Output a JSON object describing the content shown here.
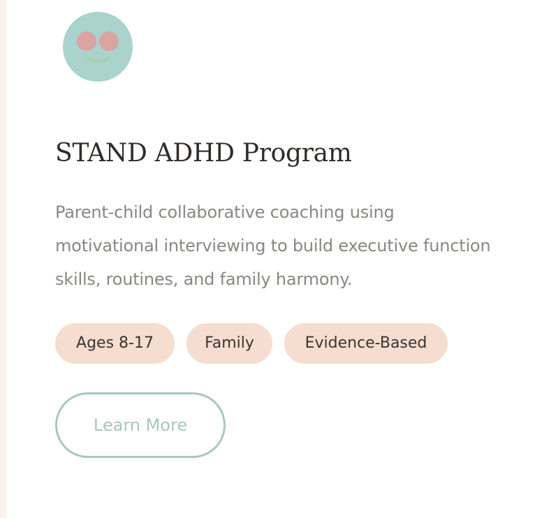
{
  "program": {
    "title": "STAND ADHD Program",
    "description": "Parent-child collaborative coaching using motivational interviewing to build executive function skills, routines, and family harmony.",
    "tags": [
      "Ages 8-17",
      "Family",
      "Evidence-Based"
    ],
    "cta_label": "Learn More"
  },
  "icon": "smiley-face-icon",
  "colors": {
    "avatar_bg": "#a9d3cc",
    "avatar_eyes": "#dba3a2",
    "avatar_mouth": "#a7cfab",
    "tag_bg": "#f5ddd0",
    "accent": "#a8c8bb",
    "title": "#2f2c2a",
    "body_text": "#8a8682"
  }
}
